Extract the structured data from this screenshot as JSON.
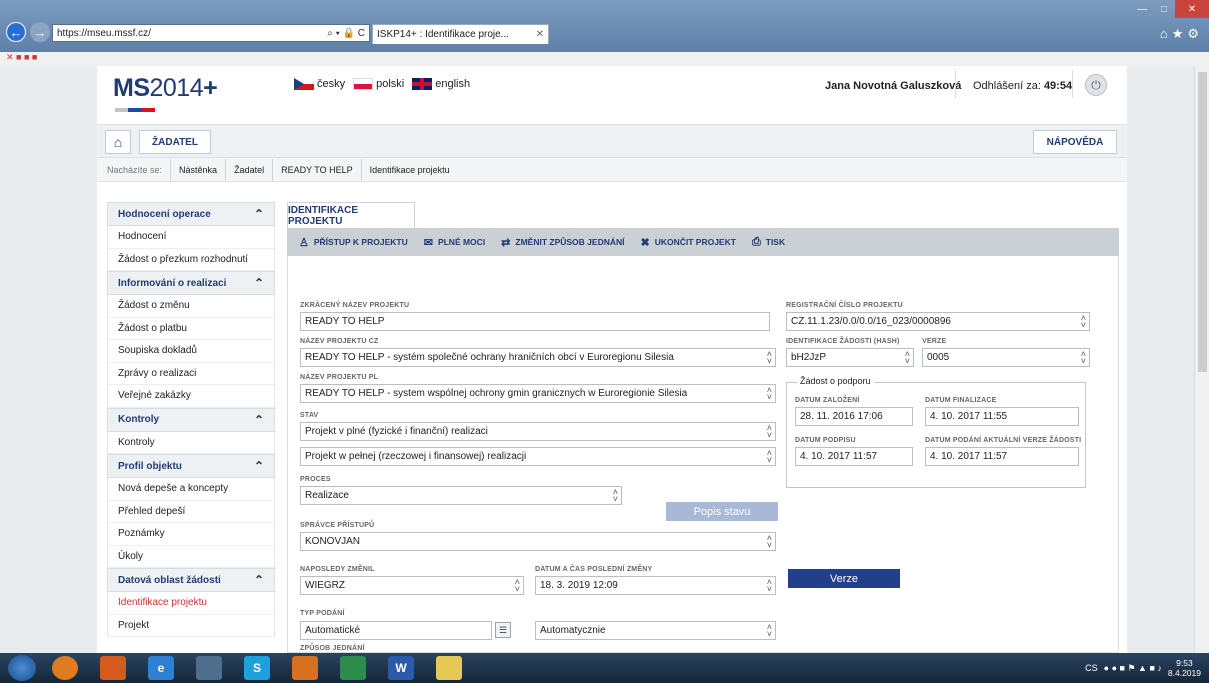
{
  "browser": {
    "url": "https://mseu.mssf.cz/",
    "tab_title": "ISKP14+ : Identifikace proje...",
    "address_tools": "⌕ ▾ 🔒 C"
  },
  "header": {
    "logo_main": "MS",
    "logo_year": "2014",
    "logo_plus": "+",
    "languages": [
      "česky",
      "polski",
      "english"
    ],
    "user_name": "Jana Novotná Galuszková",
    "logout_label": "Odhlášení za:",
    "logout_time": "49:54"
  },
  "topnav": {
    "zadatel": "ŽADATEL",
    "help": "NÁPOVĚDA"
  },
  "breadcrumb": {
    "lead": "Nacházíte se:",
    "items": [
      "Nástěnka",
      "Žadatel",
      "READY TO HELP",
      "Identifikace projektu"
    ]
  },
  "sidebar": {
    "sections": [
      {
        "title": "Hodnocení operace",
        "items": [
          "Hodnocení",
          "Žádost o přezkum rozhodnutí"
        ]
      },
      {
        "title": "Informování o realizaci",
        "items": [
          "Žádost o změnu",
          "Žádost o platbu",
          "Soupiska dokladů",
          "Zprávy o realizaci",
          "Veřejné zakázky"
        ]
      },
      {
        "title": "Kontroly",
        "items": [
          "Kontroly"
        ]
      },
      {
        "title": "Profil objektu",
        "items": [
          "Nová depeše a koncepty",
          "Přehled depeší",
          "Poznámky",
          "Úkoly"
        ]
      },
      {
        "title": "Datová oblast žádosti",
        "items": [
          "Identifikace projektu",
          "Projekt"
        ]
      }
    ]
  },
  "main": {
    "tab": "IDENTIFIKACE PROJEKTU",
    "toolbar": [
      "PŘÍSTUP K PROJEKTU",
      "PLNÉ MOCI",
      "ZMĚNIT ZPŮSOB JEDNÁNÍ",
      "UKONČIT PROJEKT",
      "TISK"
    ]
  },
  "form": {
    "short_name_label": "ZKRÁCENÝ NÁZEV PROJEKTU",
    "short_name": "READY TO HELP",
    "name_cz_label": "NÁZEV PROJEKTU CZ",
    "name_cz": "READY TO HELP - systém společné ochrany hraničních obcí v Euroregionu Silesia",
    "name_pl_label": "NÁZEV PROJEKTU PL",
    "name_pl": "READY TO HELP - system wspólnej ochrony gmin granicznych w Euroregionie Silesia",
    "stav_label": "STAV",
    "stav_cz": "Projekt v plné (fyzické i finanční) realizaci",
    "stav_pl": "Projekt w pełnej (rzeczowej i finansowej) realizacji",
    "proces_label": "PROCES",
    "proces": "Realizace",
    "popis_stavu": "Popis stavu",
    "spravce_label": "SPRÁVCE PŘÍSTUPŮ",
    "spravce": "KONOVJAN",
    "naposledy_label": "NAPOSLEDY ZMĚNIL",
    "naposledy": "WIEGRZ",
    "datum_zmeny_label": "DATUM A ČAS POSLEDNÍ ZMĚNY",
    "datum_zmeny": "18. 3. 2019 12:09",
    "verze_button": "Verze",
    "typ_podani_label": "TYP PODÁNÍ",
    "typ_podani": "Automatické",
    "typ_podani_pl": "Automatycznie",
    "zpusob_label": "ZPŮSOB JEDNÁNÍ",
    "reg_label": "REGISTRAČNÍ ČÍSLO PROJEKTU",
    "reg": "CZ.11.1.23/0.0/0.0/16_023/0000896",
    "hash_label": "IDENTIFIKACE ŽÁDOSTI (HASH)",
    "hash": "bH2JzP",
    "verze_label": "VERZE",
    "verze": "0005",
    "support_legend": "Žádost o podporu",
    "datum_zalozeni_label": "DATUM ZALOŽENÍ",
    "datum_zalozeni": "28. 11. 2016 17:06",
    "datum_finalizace_label": "DATUM FINALIZACE",
    "datum_finalizace": "4. 10. 2017 11:55",
    "datum_podpisu_label": "DATUM PODPISU",
    "datum_podpisu": "4. 10. 2017 11:57",
    "datum_podani_label": "DATUM PODÁNÍ AKTUÁLNÍ VERZE ŽÁDOSTI",
    "datum_podani": "4. 10. 2017 11:57"
  },
  "taskbar": {
    "lang": "CS",
    "time": "9:53",
    "date": "8.4.2019"
  }
}
